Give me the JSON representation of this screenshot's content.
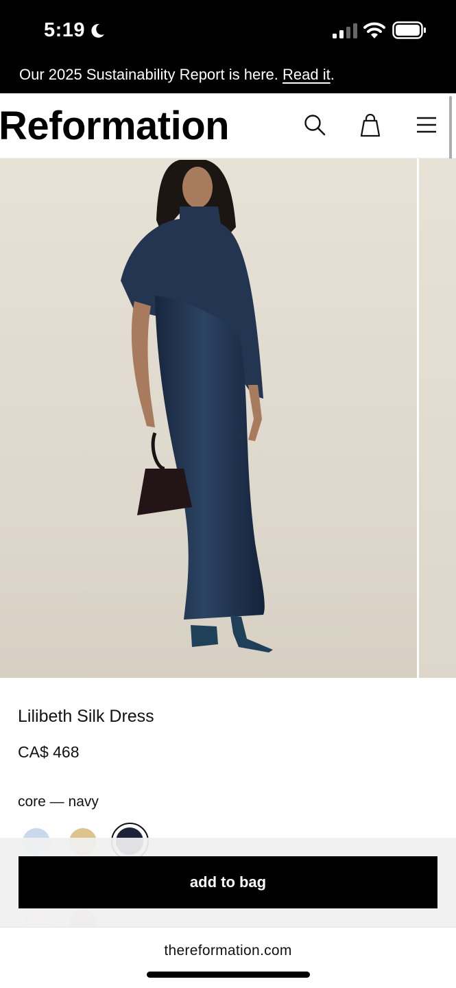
{
  "status_bar": {
    "time": "5:19",
    "icons": [
      "moon-icon",
      "cellular-signal-icon",
      "wifi-icon",
      "battery-icon"
    ]
  },
  "announcement": {
    "text": "Our 2025 Sustainability Report is here. ",
    "link_label": "Read it",
    "suffix": "."
  },
  "header": {
    "logo": "Reformation",
    "icons": [
      "search-icon",
      "shopping-bag-icon",
      "hamburger-menu-icon"
    ]
  },
  "product": {
    "title": "Lilibeth Silk Dress",
    "price": "CA$ 468",
    "color_label": "core — navy",
    "swatches": [
      {
        "name": "light blue",
        "color": "#c9d8ea"
      },
      {
        "name": "tan",
        "color": "#ddc38e"
      },
      {
        "name": "navy",
        "color": "#1c2338",
        "selected": true
      },
      {
        "name": "pink",
        "color": "#f5dbe2"
      },
      {
        "name": "rose",
        "color": "#ecc1d2"
      }
    ]
  },
  "cta": {
    "add_to_bag_label": "add to bag"
  },
  "browser": {
    "url": "thereformation.com"
  },
  "colors": {
    "black": "#000000",
    "navy_dress": "#1f2f4a",
    "backdrop": "#e4ded3"
  }
}
